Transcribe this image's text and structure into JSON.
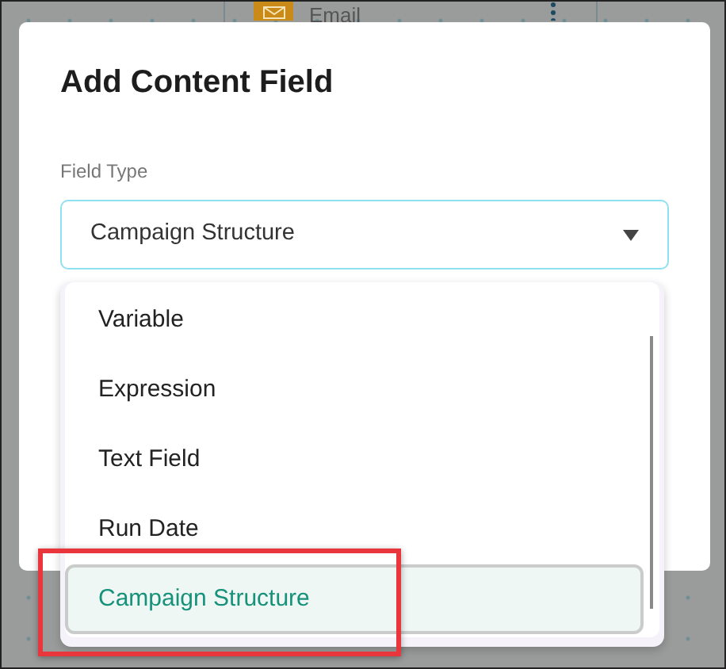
{
  "background": {
    "node": {
      "label": "Email"
    }
  },
  "dialog": {
    "title": "Add Content Field",
    "field": {
      "label": "Field Type",
      "value": "Campaign Structure",
      "expanded": true
    },
    "options": [
      {
        "label": "Variable",
        "selected": false,
        "highlighted": false
      },
      {
        "label": "Expression",
        "selected": false,
        "highlighted": false
      },
      {
        "label": "Text Field",
        "selected": false,
        "highlighted": false
      },
      {
        "label": "Run Date",
        "selected": false,
        "highlighted": false
      },
      {
        "label": "Campaign Structure",
        "selected": true,
        "highlighted": true
      }
    ]
  }
}
